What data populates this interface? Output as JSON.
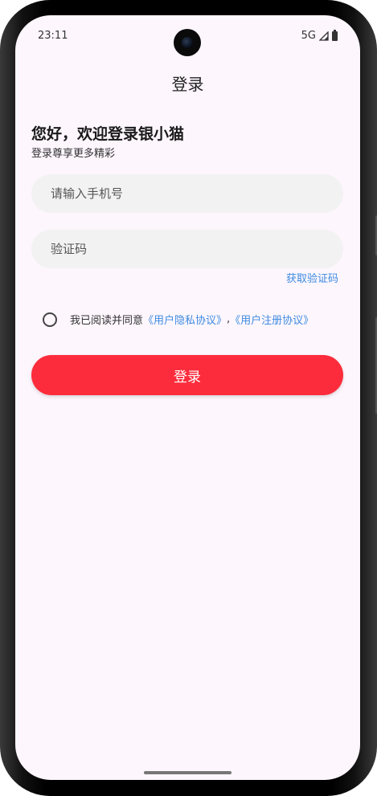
{
  "status_bar": {
    "time": "23:11",
    "network": "5G"
  },
  "header": {
    "title": "登录"
  },
  "welcome": {
    "greeting": "您好，欢迎登录银小猫",
    "subtitle": "登录尊享更多精彩"
  },
  "form": {
    "phone_placeholder": "请输入手机号",
    "phone_value": "",
    "code_placeholder": "验证码",
    "code_value": "",
    "get_code_label": "获取验证码"
  },
  "agreement": {
    "checked": false,
    "prefix": "我已阅读并同意",
    "privacy_link": "《用户隐私协议》",
    "separator": ",",
    "register_link": "《用户注册协议》"
  },
  "actions": {
    "login_label": "登录"
  },
  "colors": {
    "accent_red": "#fd2c3c",
    "link_blue": "#3d8be0",
    "background": "#fdf6fd"
  }
}
